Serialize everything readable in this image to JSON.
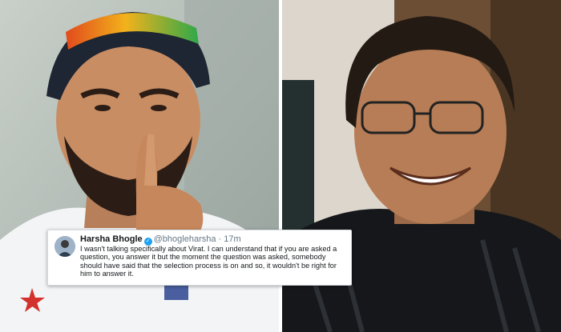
{
  "tweet": {
    "name": "Harsha Bhogle",
    "handle": "@bhogleharsha",
    "separator": "·",
    "time": "17m",
    "text": "I wasn't talking specifically about Virat. I can understand that if you are asked a question, you answer it but the moment the question was asked, somebody should have said that the selection process is on and so, it wouldn't be right for him to answer it."
  },
  "colors": {
    "verified": "#1da1f2",
    "card_border": "#d6dbe0"
  }
}
